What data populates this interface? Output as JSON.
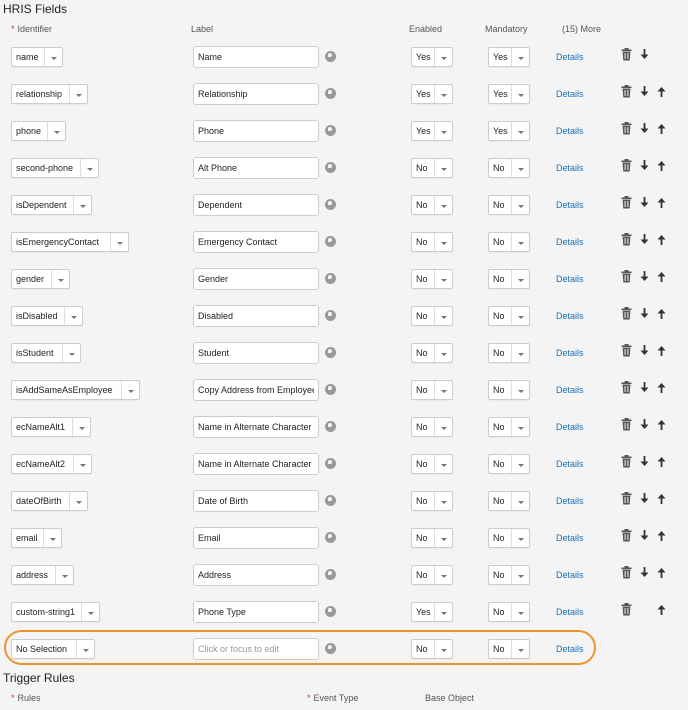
{
  "hris": {
    "title": "HRIS Fields",
    "headers": {
      "identifier": "Identifier",
      "label": "Label",
      "enabled": "Enabled",
      "mandatory": "Mandatory",
      "more": "(15) More"
    },
    "details_label": "Details",
    "rows": [
      {
        "identifier": "name",
        "label": "Name",
        "enabled": "Yes",
        "mandatory": "Yes",
        "delete": true,
        "down": true,
        "up": false
      },
      {
        "identifier": "relationship",
        "label": "Relationship",
        "enabled": "Yes",
        "mandatory": "Yes",
        "delete": true,
        "down": true,
        "up": true
      },
      {
        "identifier": "phone",
        "label": "Phone",
        "enabled": "Yes",
        "mandatory": "Yes",
        "delete": true,
        "down": true,
        "up": true
      },
      {
        "identifier": "second-phone",
        "label": "Alt Phone",
        "enabled": "No",
        "mandatory": "No",
        "delete": true,
        "down": true,
        "up": true
      },
      {
        "identifier": "isDependent",
        "label": "Dependent",
        "enabled": "No",
        "mandatory": "No",
        "delete": true,
        "down": true,
        "up": true
      },
      {
        "identifier": "isEmergencyContact",
        "label": "Emergency Contact",
        "enabled": "No",
        "mandatory": "No",
        "delete": true,
        "down": true,
        "up": true
      },
      {
        "identifier": "gender",
        "label": "Gender",
        "enabled": "No",
        "mandatory": "No",
        "delete": true,
        "down": true,
        "up": true
      },
      {
        "identifier": "isDisabled",
        "label": "Disabled",
        "enabled": "No",
        "mandatory": "No",
        "delete": true,
        "down": true,
        "up": true
      },
      {
        "identifier": "isStudent",
        "label": "Student",
        "enabled": "No",
        "mandatory": "No",
        "delete": true,
        "down": true,
        "up": true
      },
      {
        "identifier": "isAddSameAsEmployee",
        "label": "Copy Address from Employee",
        "enabled": "No",
        "mandatory": "No",
        "delete": true,
        "down": true,
        "up": true
      },
      {
        "identifier": "ecNameAlt1",
        "label": "Name in Alternate Character",
        "enabled": "No",
        "mandatory": "No",
        "delete": true,
        "down": true,
        "up": true
      },
      {
        "identifier": "ecNameAlt2",
        "label": "Name in Alternate Character",
        "enabled": "No",
        "mandatory": "No",
        "delete": true,
        "down": true,
        "up": true
      },
      {
        "identifier": "dateOfBirth",
        "label": "Date of Birth",
        "enabled": "No",
        "mandatory": "No",
        "delete": true,
        "down": true,
        "up": true
      },
      {
        "identifier": "email",
        "label": "Email",
        "enabled": "No",
        "mandatory": "No",
        "delete": true,
        "down": true,
        "up": true
      },
      {
        "identifier": "address",
        "label": "Address",
        "enabled": "No",
        "mandatory": "No",
        "delete": true,
        "down": true,
        "up": true
      },
      {
        "identifier": "custom-string1",
        "label": "Phone Type",
        "enabled": "Yes",
        "mandatory": "No",
        "delete": true,
        "down": false,
        "up": true
      },
      {
        "identifier": "No Selection",
        "label": "",
        "placeholder": "Click or focus to edit",
        "enabled": "No",
        "mandatory": "No",
        "delete": false,
        "down": false,
        "up": false,
        "highlighted": true
      }
    ]
  },
  "trigger": {
    "title": "Trigger Rules",
    "headers": {
      "rules": "Rules",
      "event_type": "Event Type",
      "base_object": "Base Object"
    }
  },
  "icons": {
    "globe": "globe-icon",
    "delete": "trash-icon",
    "down": "arrow-down-icon",
    "up": "arrow-up-icon",
    "dropdown": "chevron-down-icon"
  },
  "colors": {
    "link": "#1a6fb5",
    "required": "#c0392b",
    "highlight": "#f0922b"
  }
}
